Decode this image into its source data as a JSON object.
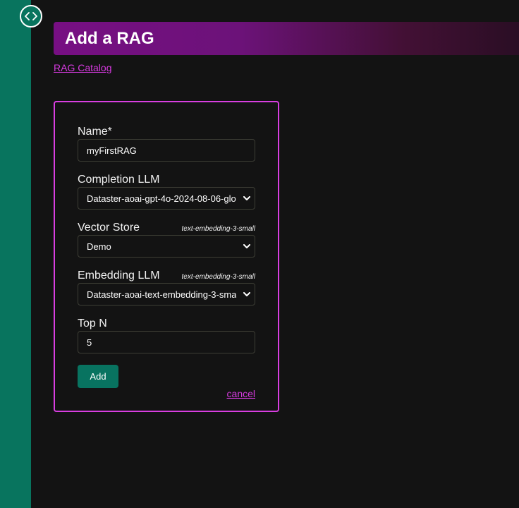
{
  "header": {
    "title": "Add a RAG"
  },
  "breadcrumb": {
    "label": "RAG Catalog"
  },
  "form": {
    "name": {
      "label": "Name*",
      "value": "myFirstRAG"
    },
    "completion_llm": {
      "label": "Completion LLM",
      "value": "Dataster-aoai-gpt-4o-2024-08-06-glo"
    },
    "vector_store": {
      "label": "Vector Store",
      "tag": "text-embedding-3-small",
      "value": "Demo"
    },
    "embedding_llm": {
      "label": "Embedding LLM",
      "tag": "text-embedding-3-small",
      "value": "Dataster-aoai-text-embedding-3-sma"
    },
    "top_n": {
      "label": "Top N",
      "value": "5"
    },
    "add_label": "Add",
    "cancel_label": "cancel"
  },
  "icons": {
    "sidebar_toggle": "code-brackets-icon",
    "select_arrow": "chevron-down-icon"
  },
  "colors": {
    "accent": "#d83ee0",
    "brand_green": "#08745e",
    "header_purple": "#770f83",
    "background": "#131313"
  }
}
